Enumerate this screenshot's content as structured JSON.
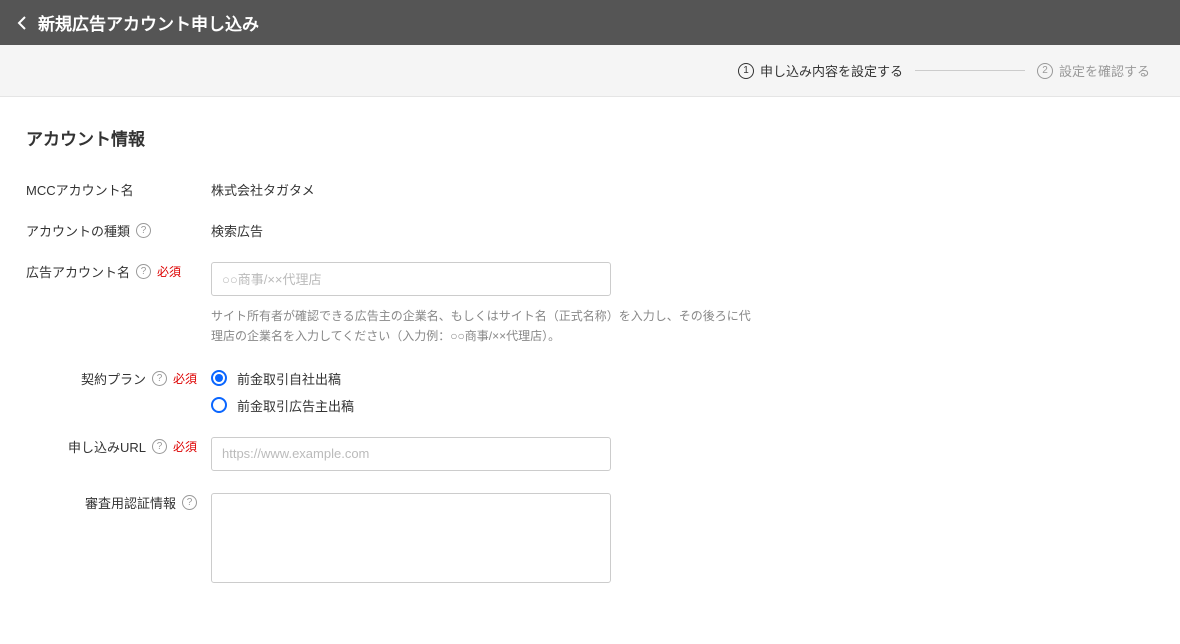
{
  "header": {
    "title": "新規広告アカウント申し込み"
  },
  "stepper": {
    "step1_num": "1",
    "step1_label": "申し込み内容を設定する",
    "step2_num": "2",
    "step2_label": "設定を確認する"
  },
  "section": {
    "title": "アカウント情報"
  },
  "fields": {
    "mcc_label": "MCCアカウント名",
    "mcc_value": "株式会社タガタメ",
    "acct_type_label": "アカウントの種類",
    "acct_type_value": "検索広告",
    "ad_acct_name_label": "広告アカウント名",
    "ad_acct_name_placeholder": "○○商事/××代理店",
    "ad_acct_name_hint": "サイト所有者が確認できる広告主の企業名、もしくはサイト名（正式名称）を入力し、その後ろに代理店の企業名を入力してください（入力例：○○商事/××代理店）。",
    "plan_label": "契約プラン",
    "plan_option1": "前金取引自社出稿",
    "plan_option2": "前金取引広告主出稿",
    "url_label": "申し込みURL",
    "url_placeholder": "https://www.example.com",
    "auth_info_label": "審査用認証情報"
  },
  "labels": {
    "required": "必須",
    "help": "?"
  }
}
